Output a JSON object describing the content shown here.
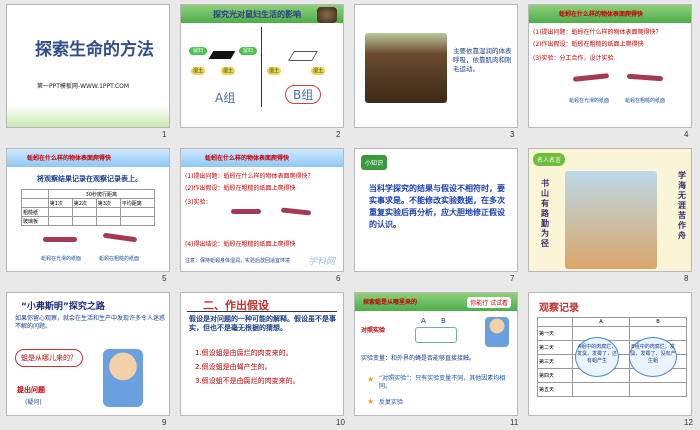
{
  "slides": [
    {
      "num": "1",
      "title": "探索生命的方法",
      "subtitle": "第一PPT模板网-WWW.1PPT.COM"
    },
    {
      "num": "2",
      "title": "探究光对鼠妇生活的影响",
      "groupA": "A组",
      "groupB": "B组",
      "tags": [
        "鼠妇",
        "鼠妇",
        "湿土",
        "湿土",
        "湿土",
        "湿土"
      ]
    },
    {
      "num": "3",
      "text": "主要依靠湿润的体表呼吸，依靠肌肉和刚毛运动。"
    },
    {
      "num": "4",
      "header": "蚯蚓在什么样的物体表面爬得快",
      "q1": "(1)提出问题：蚯蚓在什么样的物体表面爬得快？",
      "q2": "(2)作出假设：蚯蚓在粗糙的纸面上爬得快",
      "q3": "(3)实验：分工合作，设计实验",
      "cap1": "蚯蚓在光滑的纸面",
      "cap2": "蚯蚓在粗糙的纸面"
    },
    {
      "num": "5",
      "header": "蚯蚓在什么样的物体表面爬得快",
      "title": "将观察结果记录在观察记录表上。",
      "table_header": "30秒爬行距离",
      "cols": [
        "第1次",
        "第2次",
        "第3次",
        "平均距离"
      ],
      "rows": [
        "粗糙纸",
        "玻璃板"
      ],
      "cap1": "蚯蚓在光滑的纸面",
      "cap2": "蚯蚓在粗糙的纸面"
    },
    {
      "num": "6",
      "header": "蚯蚓在什么样的物体表面爬得快",
      "l1": "(1)提出问题：蚯蚓在什么样的物体表面爬得快？",
      "l2": "(2)作出假设：蚯蚓在粗糙的纸面上爬得快",
      "l3": "(3)实验：",
      "l4": "(4)得出结论：蚯蚓在粗糙的纸面上爬得快",
      "l5": "注意：保持蚯蚓身体湿润，实验后放回适宜环境",
      "watermark": "学科网"
    },
    {
      "num": "7",
      "badge": "小知识",
      "text": "当科学探究的结果与假设不相符时，要实事求是。不能修改实验数据，在多次重复实验后再分析，应大胆地修正假设的认识。"
    },
    {
      "num": "8",
      "badge": "名人名言",
      "quote": "学海无涯苦作舟",
      "quote2": "书山有路勤为径"
    },
    {
      "num": "9",
      "title": "“小弗斯明”探究之路",
      "text": "如果你留心观察，就会在生活和生产中发现许多令人迷惑不解的问题。",
      "bubble": "蛆是从哪儿来的？",
      "action": "提出问题",
      "action2": "(疑问)"
    },
    {
      "num": "10",
      "title": "二、作出假设",
      "intro": "假设是对问题的一种可能的解释。假设虽不是事实，但也不是毫无根据的猜想。",
      "h1": "1.假设蛆是由腐烂的肉变来的。",
      "h2": "2.假设蛆是由蝇产生的。",
      "h3": "3.假设蛆不是由腐烂的肉变来的。"
    },
    {
      "num": "11",
      "header": "探索蛆是从哪里来的",
      "tab": "你能行 试试看",
      "label": "对照实验",
      "A": "A",
      "B": "B",
      "line": "实验变量：和外界的蝇是否能够直接接触。",
      "b1": "“对照实验”：只有实验变量不同，其他因素均相同。",
      "b2": "反复实验"
    },
    {
      "num": "12",
      "title": "观察记录",
      "cols": [
        "A",
        "B"
      ],
      "rows": [
        "第一天",
        "第二天",
        "第三天",
        "第四天",
        "第五天"
      ],
      "noteA": "A组中的肉腐烂，发臭，发霉了，还有蛆产生",
      "noteB": "B组中的肉腐烂，发臭，发霉了，没有产生蛆"
    }
  ]
}
